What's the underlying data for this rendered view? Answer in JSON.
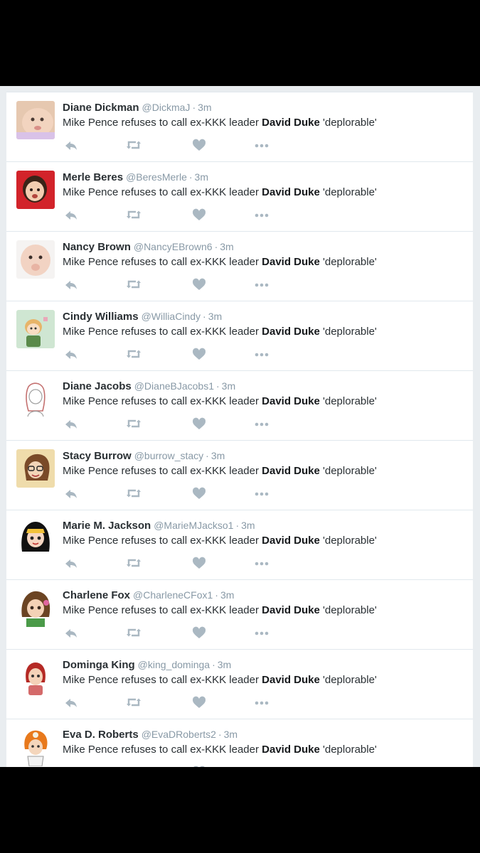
{
  "tweet_text": {
    "before": "Mike Pence refuses to call ex-KKK leader ",
    "bold": "David Duke",
    "after": " 'deplorable'"
  },
  "separator": "·",
  "tweets": [
    {
      "name": "Diane Dickman",
      "handle": "@DickmaJ",
      "time": "3m",
      "avatar": "baby-photo-1"
    },
    {
      "name": "Merle Beres",
      "handle": "@BeresMerle",
      "time": "3m",
      "avatar": "baby-photo-2"
    },
    {
      "name": "Nancy Brown",
      "handle": "@NancyEBrown6",
      "time": "3m",
      "avatar": "baby-photo-3"
    },
    {
      "name": "Cindy Williams",
      "handle": "@WilliaCindy",
      "time": "3m",
      "avatar": "cartoon-girl-green"
    },
    {
      "name": "Diane Jacobs",
      "handle": "@DianeBJacobs1",
      "time": "3m",
      "avatar": "sketch-girl"
    },
    {
      "name": "Stacy Burrow",
      "handle": "@burrow_stacy",
      "time": "3m",
      "avatar": "cartoon-woman-glasses"
    },
    {
      "name": "Marie M. Jackson",
      "handle": "@MarieMJackso1",
      "time": "3m",
      "avatar": "cartoon-girl-black-hair"
    },
    {
      "name": "Charlene Fox",
      "handle": "@CharleneCFox1",
      "time": "3m",
      "avatar": "cartoon-girl-brown-hair"
    },
    {
      "name": "Dominga King",
      "handle": "@king_dominga",
      "time": "3m",
      "avatar": "cartoon-woman-red-hair"
    },
    {
      "name": "Eva D. Roberts",
      "handle": "@EvaDRoberts2",
      "time": "3m",
      "avatar": "cartoon-woman-orange-hair"
    }
  ],
  "action_icons": [
    "reply-icon",
    "retweet-icon",
    "like-icon",
    "more-icon"
  ],
  "colors": {
    "name": "#292f33",
    "meta": "#8899a6",
    "icon": "#aab8c2",
    "divider": "#e1e8ed",
    "background": "#e9edf0"
  }
}
